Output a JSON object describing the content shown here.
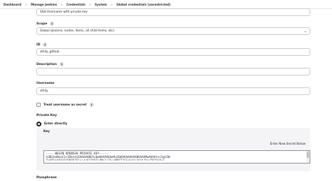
{
  "breadcrumb": {
    "items": [
      "Dashboard",
      "Manage Jenkins",
      "Credentials",
      "System",
      "Global credentials (unrestricted)"
    ],
    "separator": ">"
  },
  "kind": {
    "value": "SSH Username with private key"
  },
  "scope": {
    "label": "Scope",
    "help": "?",
    "value": "Global (Jenkins, nodes, items, all child items, etc)"
  },
  "id": {
    "label": "ID",
    "help": "?",
    "value": "sthily_github"
  },
  "description": {
    "label": "Description",
    "help": "?",
    "value": ""
  },
  "username": {
    "label": "Username",
    "value": "sthily"
  },
  "treat_secret": {
    "label": "Treat username as secret",
    "help": "?",
    "checked": false
  },
  "private_key": {
    "label": "Private Key",
    "option_label": "Enter directly",
    "key_label": "Key",
    "enter_new": "Enter New Secret Below",
    "lines": [
      "-----BEGIN OPENSSH PRIVATE KEY-----",
      "b3BlbnNzaC1rZXktdjEAAAAABG5vbmUAAAAEbm9uZQAAAAAAAAABAAAAMwAAAAtzc2gtZW",
      "QyNTUxOQAAACDBXBJh1ni4sK1QtRZcdMo1i7bsqM8Y72CSqSzUi4AAAJYmrTBZZqPwG"
    ]
  },
  "passphrase": {
    "label": "Passphrase"
  }
}
